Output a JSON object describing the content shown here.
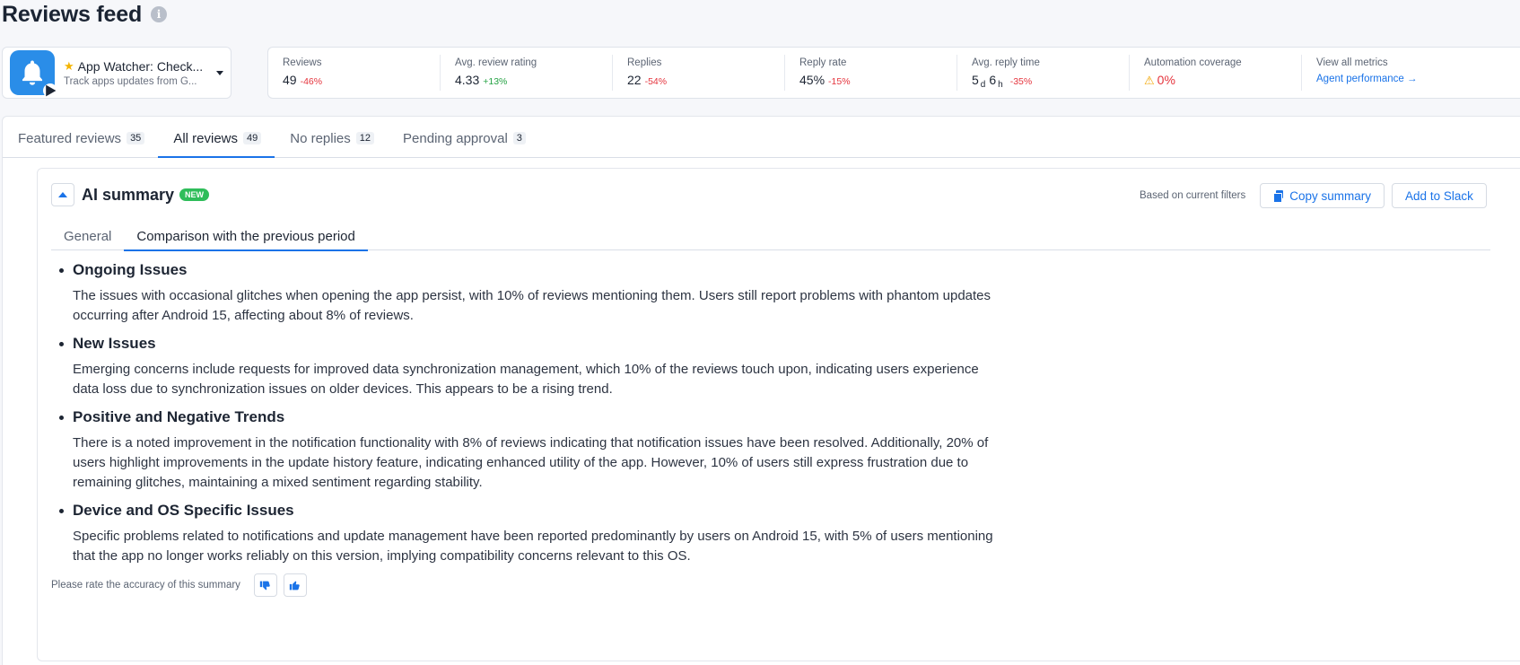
{
  "page": {
    "title": "Reviews feed",
    "info_icon": "info-icon"
  },
  "app": {
    "name": "App Watcher: Check...",
    "subtitle": "Track apps updates from G...",
    "icon": "bell-icon",
    "store_badge": "google-play-icon"
  },
  "metrics": [
    {
      "label": "Reviews",
      "value": "49",
      "delta": "-46%",
      "trend": "negative"
    },
    {
      "label": "Avg. review rating",
      "value": "4.33",
      "delta": "+13%",
      "trend": "positive"
    },
    {
      "label": "Replies",
      "value": "22",
      "delta": "-54%",
      "trend": "negative"
    },
    {
      "label": "Reply rate",
      "value": "45%",
      "delta": "-15%",
      "trend": "negative"
    },
    {
      "label": "Avg. reply time",
      "days": "5",
      "days_unit": "d",
      "hours": "6",
      "hours_unit": "h",
      "delta": "-35%",
      "trend": "negative"
    },
    {
      "label": "Automation coverage",
      "value": "0%",
      "icon": "warning-icon",
      "trend": "negative"
    },
    {
      "label": "View all metrics",
      "link": "Agent performance →"
    }
  ],
  "tabs": [
    {
      "label": "Featured reviews",
      "count": "35",
      "active": false
    },
    {
      "label": "All reviews",
      "count": "49",
      "active": true
    },
    {
      "label": "No replies",
      "count": "12",
      "active": false
    },
    {
      "label": "Pending approval",
      "count": "3",
      "active": false
    }
  ],
  "ai_summary": {
    "title": "AI summary",
    "badge": "NEW",
    "based_on": "Based on current filters",
    "copy_label": "Copy summary",
    "slack_label": "Add to Slack",
    "sub_tabs": [
      {
        "label": "General",
        "active": false
      },
      {
        "label": "Comparison with the previous period",
        "active": true
      }
    ],
    "sections": [
      {
        "title": "Ongoing Issues",
        "body": "The issues with occasional glitches when opening the app persist, with 10% of reviews mentioning them. Users still report problems with phantom updates occurring after Android 15, affecting about 8% of reviews."
      },
      {
        "title": "New Issues",
        "body": "Emerging concerns include requests for improved data synchronization management, which 10% of the reviews touch upon, indicating users experience data loss due to synchronization issues on older devices. This appears to be a rising trend."
      },
      {
        "title": "Positive and Negative Trends",
        "body": "There is a noted improvement in the notification functionality with 8% of reviews indicating that notification issues have been resolved. Additionally, 20% of users highlight improvements in the update history feature, indicating enhanced utility of the app. However, 10% of users still express frustration due to remaining glitches, maintaining a mixed sentiment regarding stability."
      },
      {
        "title": "Device and OS Specific Issues",
        "body": "Specific problems related to notifications and update management have been reported predominantly by users on Android 15, with 5% of users mentioning that the app no longer works reliably on this version, implying compatibility concerns relevant to this OS."
      }
    ],
    "rate_label": "Please rate the accuracy of this summary"
  },
  "colors": {
    "accent": "#1a73e8",
    "negative": "#e5343d",
    "positive": "#25a244",
    "new_badge": "#2fbd5a",
    "app_icon_bg": "#2a8de8"
  }
}
